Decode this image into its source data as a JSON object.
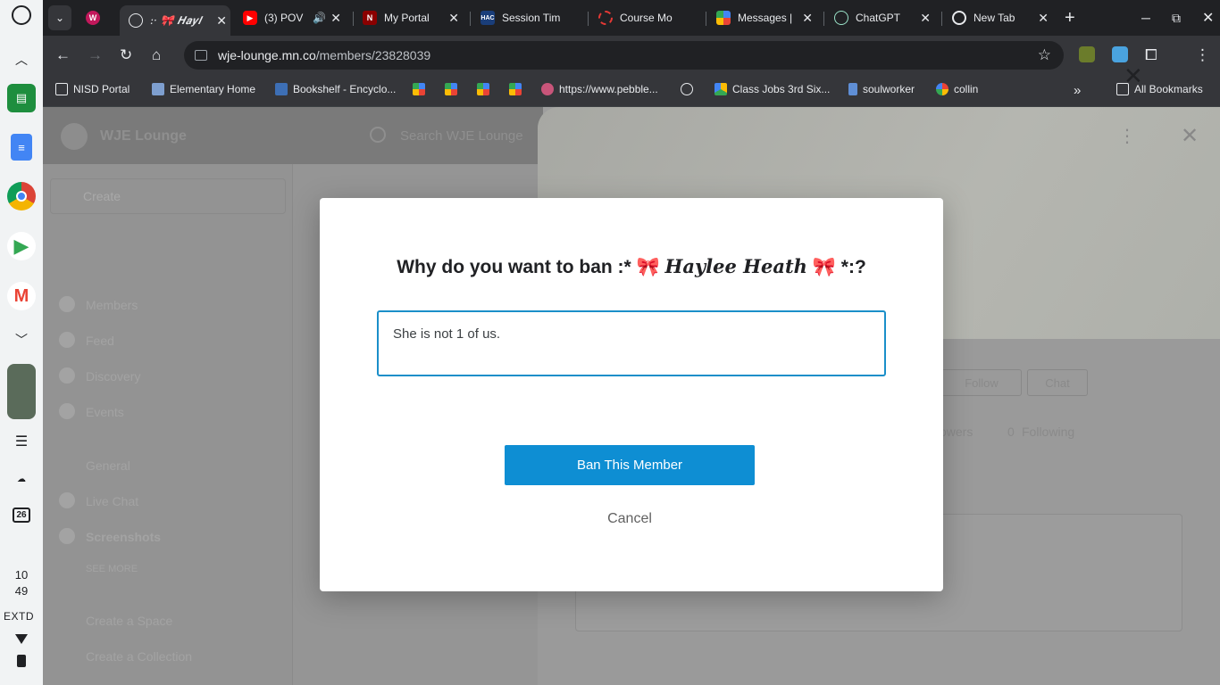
{
  "shelf": {
    "clock_hour": "10",
    "clock_minute": "49",
    "display_label": "EXTD",
    "calendar_day": "26"
  },
  "tabs": [
    {
      "title": "",
      "favicon": "W"
    },
    {
      "title": ":· 🎀 𝑯𝒂𝒚𝒍",
      "active": true
    },
    {
      "title": "(3) POV"
    },
    {
      "title": "My Portal"
    },
    {
      "title": "Session Tim"
    },
    {
      "title": "Course Mo"
    },
    {
      "title": "Messages |"
    },
    {
      "title": "ChatGPT"
    },
    {
      "title": "New Tab"
    }
  ],
  "address_bar": {
    "host": "wje-lounge.mn.co",
    "path": "/members/23828039"
  },
  "bookmarks": [
    {
      "label": "NISD Portal"
    },
    {
      "label": "Elementary Home"
    },
    {
      "label": "Bookshelf - Encyclo..."
    },
    {
      "label": "https://www.pebble..."
    },
    {
      "label": "Class Jobs 3rd Six..."
    },
    {
      "label": "soulworker"
    },
    {
      "label": "collin"
    },
    {
      "label": "All Bookmarks"
    }
  ],
  "site": {
    "name": "WJE Lounge",
    "search_placeholder": "Search WJE Lounge",
    "create_label": "Create",
    "nav": [
      "Members",
      "Feed",
      "Discovery",
      "Events"
    ],
    "section_general": "General",
    "nav_live_chat": "Live Chat",
    "nav_screenshots": "Screenshots",
    "see_more": "SEE MORE",
    "create_space": "Create a Space",
    "create_collection": "Create a Collection",
    "follow_label": "Follow",
    "chat_label": "Chat",
    "followers_label": "owers",
    "following_count": "0",
    "following_label": "Following"
  },
  "modal": {
    "title_prefix": "Why do you want to ban :* 🎀 ",
    "title_name": "Haylee Heath",
    "title_suffix": " 🎀 *:?",
    "reason_value": "She is not 1 of us.",
    "ban_button": "Ban This Member",
    "cancel": "Cancel"
  },
  "colors": {
    "accent": "#0e8ed3",
    "focus_border": "#1b8fc9"
  }
}
